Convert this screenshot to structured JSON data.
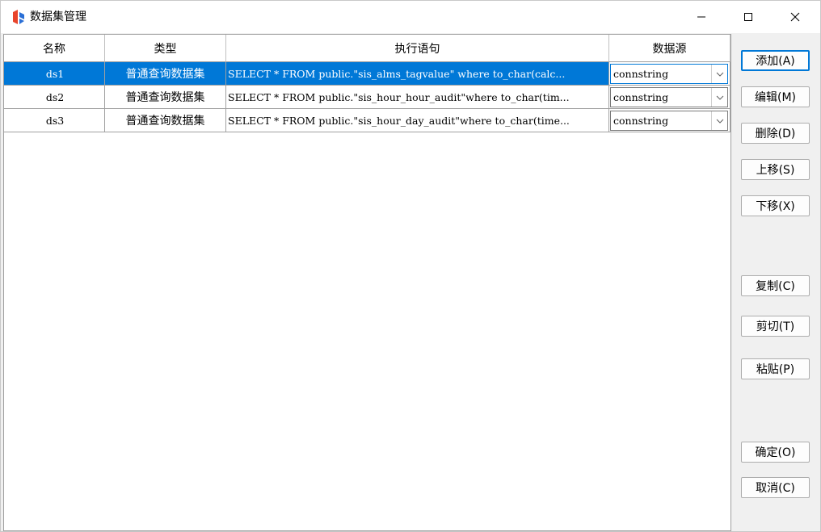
{
  "window": {
    "title": "数据集管理"
  },
  "grid": {
    "columns": [
      "名称",
      "类型",
      "执行语句",
      "数据源"
    ],
    "rows": [
      {
        "name": "ds1",
        "type": "普通查询数据集",
        "sql": "SELECT * FROM public.\"sis_alms_tagvalue\" where to_char(calc...",
        "datasource": "connstring",
        "selected": true
      },
      {
        "name": "ds2",
        "type": "普通查询数据集",
        "sql": "SELECT * FROM public.\"sis_hour_hour_audit\"where to_char(tim...",
        "datasource": "connstring",
        "selected": false
      },
      {
        "name": "ds3",
        "type": "普通查询数据集",
        "sql": "SELECT * FROM public.\"sis_hour_day_audit\"where to_char(time...",
        "datasource": "connstring",
        "selected": false
      }
    ]
  },
  "buttons": {
    "add": "添加(A)",
    "edit": "编辑(M)",
    "delete": "删除(D)",
    "up": "上移(S)",
    "down": "下移(X)",
    "copy": "复制(C)",
    "cut": "剪切(T)",
    "paste": "粘贴(P)",
    "ok": "确定(O)",
    "cancel": "取消(C)"
  },
  "colors": {
    "selection": "#0078d7",
    "logo_red": "#e8452c",
    "logo_blue": "#2a6fd6"
  },
  "icons": {
    "app": "app-logo-icon",
    "minimize": "minimize-icon",
    "maximize": "maximize-icon",
    "close": "close-icon",
    "dropdown": "chevron-down-icon"
  }
}
